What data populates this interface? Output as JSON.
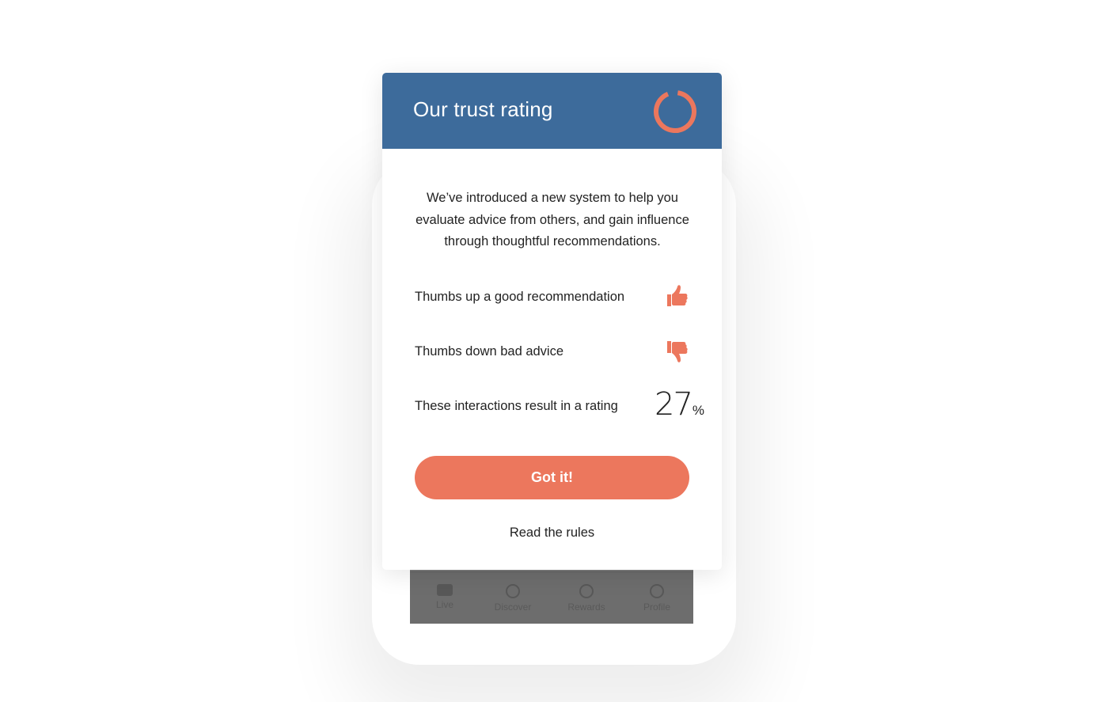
{
  "modal": {
    "title": "Our trust rating",
    "intro": "We’ve introduced a new system to help you evaluate advice from others, and gain influence through thoughtful recommendations.",
    "rows": [
      {
        "label": "Thumbs up a good recommendation",
        "icon": "thumbs-up-icon"
      },
      {
        "label": "Thumbs down bad advice",
        "icon": "thumbs-down-icon"
      },
      {
        "label": "These interactions result in a rating"
      }
    ],
    "rating": {
      "value": "27",
      "unit": "%",
      "ring_icon": "rating-ring-icon"
    },
    "primary_button": "Got it!",
    "secondary_link": "Read the rules"
  },
  "background_tabbar": {
    "tabs": [
      {
        "label": "Live",
        "icon": "chat-icon"
      },
      {
        "label": "Discover",
        "icon": "compass-icon"
      },
      {
        "label": "Rewards",
        "icon": "award-icon"
      },
      {
        "label": "Profile",
        "icon": "profile-icon"
      }
    ]
  },
  "colors": {
    "header": "#3d6b9b",
    "accent": "#ec775d",
    "text": "#222222",
    "overlay": "#6d6d6d"
  }
}
